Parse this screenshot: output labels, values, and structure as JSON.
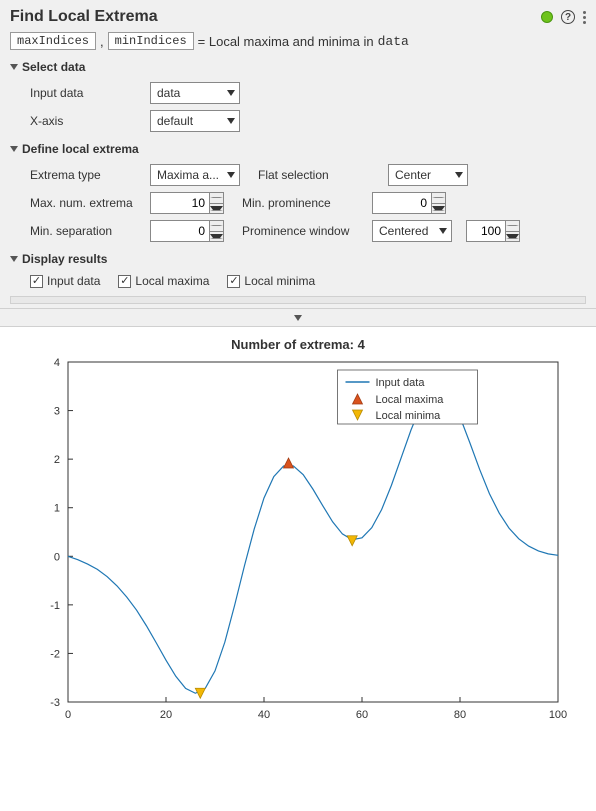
{
  "title": "Find Local Extrema",
  "equation": {
    "lhs1": "maxIndices",
    "lhs2": "minIndices",
    "desc_prefix": " =  Local maxima and minima in ",
    "desc_data": "data"
  },
  "sections": {
    "select_data": {
      "title": "Select data",
      "fields": {
        "input_data": {
          "label": "Input data",
          "value": "data"
        },
        "xaxis": {
          "label": "X-axis",
          "value": "default"
        }
      }
    },
    "define": {
      "title": "Define local extrema",
      "fields": {
        "extrema_type": {
          "label": "Extrema type",
          "value": "Maxima a..."
        },
        "flat_selection": {
          "label": "Flat selection",
          "value": "Center"
        },
        "max_num": {
          "label": "Max. num. extrema",
          "value": "10"
        },
        "min_prominence": {
          "label": "Min. prominence",
          "value": "0"
        },
        "min_separation": {
          "label": "Min. separation",
          "value": "0"
        },
        "prom_window_type": {
          "label": "Prominence window",
          "value": "Centered"
        },
        "prom_window_val": {
          "value": "100"
        }
      }
    },
    "display": {
      "title": "Display results",
      "checks": {
        "input_data": {
          "label": "Input data",
          "checked": true
        },
        "local_max": {
          "label": "Local maxima",
          "checked": true
        },
        "local_min": {
          "label": "Local minima",
          "checked": true
        }
      }
    }
  },
  "chart_data": {
    "type": "line",
    "title": "Number of extrema: 4",
    "xlabel": "",
    "ylabel": "",
    "xlim": [
      0,
      100
    ],
    "ylim": [
      -3,
      4
    ],
    "xticks": [
      0,
      20,
      40,
      60,
      80,
      100
    ],
    "yticks": [
      -3,
      -2,
      -1,
      0,
      1,
      2,
      3,
      4
    ],
    "series": [
      {
        "name": "Input data",
        "x": [
          0,
          2,
          4,
          6,
          8,
          10,
          12,
          14,
          16,
          18,
          20,
          22,
          24,
          26,
          28,
          30,
          32,
          34,
          36,
          38,
          40,
          42,
          44,
          46,
          48,
          50,
          52,
          54,
          56,
          58,
          60,
          62,
          64,
          66,
          68,
          70,
          72,
          74,
          76,
          78,
          80,
          82,
          84,
          86,
          88,
          90,
          92,
          94,
          96,
          98,
          100
        ],
        "values": [
          0.0,
          -0.07,
          -0.16,
          -0.27,
          -0.42,
          -0.61,
          -0.84,
          -1.11,
          -1.43,
          -1.78,
          -2.14,
          -2.47,
          -2.72,
          -2.82,
          -2.72,
          -2.36,
          -1.77,
          -1.01,
          -0.2,
          0.56,
          1.2,
          1.64,
          1.86,
          1.86,
          1.68,
          1.38,
          1.04,
          0.71,
          0.46,
          0.34,
          0.38,
          0.59,
          0.96,
          1.46,
          2.03,
          2.6,
          3.09,
          3.4,
          3.47,
          3.28,
          2.87,
          2.34,
          1.79,
          1.29,
          0.89,
          0.58,
          0.36,
          0.21,
          0.11,
          0.05,
          0.02
        ]
      }
    ],
    "maxima": [
      {
        "x": 45,
        "y": 1.9
      },
      {
        "x": 76,
        "y": 3.47
      }
    ],
    "minima": [
      {
        "x": 27,
        "y": -2.8
      },
      {
        "x": 58,
        "y": 0.34
      }
    ],
    "legend": {
      "items": [
        "Input data",
        "Local maxima",
        "Local minima"
      ],
      "position": "upper-center-right"
    }
  }
}
